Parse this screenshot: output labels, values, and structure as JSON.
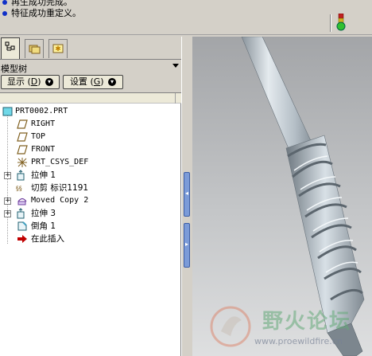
{
  "messages": [
    {
      "text": "再生成功完成。"
    },
    {
      "text": "特征成功重定义。"
    }
  ],
  "tree_panel": {
    "title": "模型树",
    "show_button": "显示",
    "show_key": "D",
    "settings_button": "设置",
    "settings_key": "G"
  },
  "tree": {
    "root": "PRT0002.PRT",
    "items": [
      {
        "label": "RIGHT",
        "icon": "datum-plane-icon"
      },
      {
        "label": "TOP",
        "icon": "datum-plane-icon"
      },
      {
        "label": "FRONT",
        "icon": "datum-plane-icon"
      },
      {
        "label": "PRT_CSYS_DEF",
        "icon": "coordinate-system-icon"
      },
      {
        "label": "拉伸 1",
        "icon": "extrude-icon"
      },
      {
        "label": "切剪 标识1191",
        "icon": "cut-icon"
      },
      {
        "label": "Moved Copy 2",
        "icon": "moved-copy-icon"
      },
      {
        "label": "拉伸 3",
        "icon": "extrude-icon"
      },
      {
        "label": "倒角 1",
        "icon": "chamfer-icon"
      },
      {
        "label": "在此插入",
        "icon": "insert-here-arrow-icon"
      }
    ]
  },
  "watermark": {
    "text": "野火论坛",
    "url": "www.proewildfire.cn"
  },
  "colors": {
    "background": "#d4d0c8",
    "viewport_bg": "#b8babc",
    "model": "#b4bec8",
    "message_dot": "#1030c8",
    "insert_arrow": "#c00000"
  }
}
